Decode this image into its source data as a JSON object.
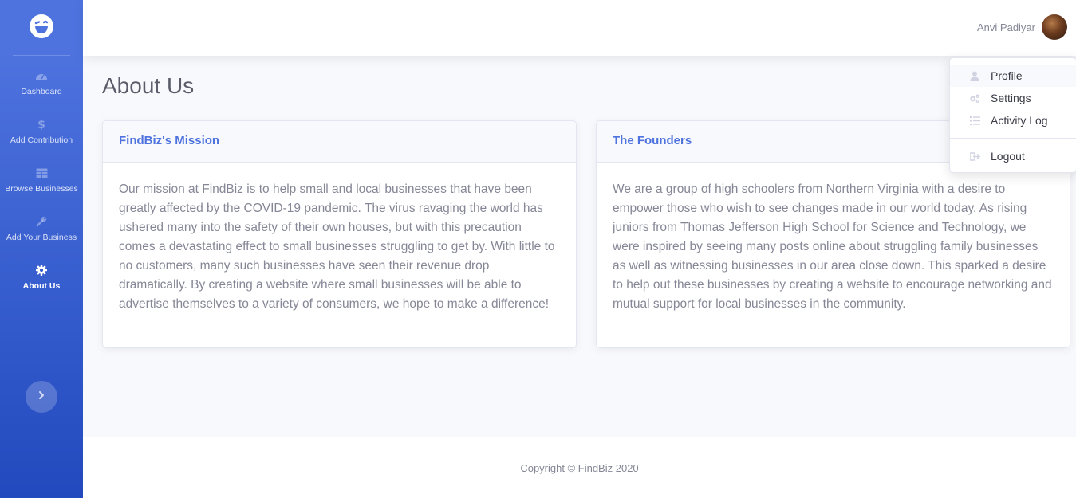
{
  "sidebar": {
    "brand_icon": "laughing-face-icon",
    "items": [
      {
        "label": "Dashboard",
        "icon": "tachometer-icon"
      },
      {
        "label": "Add Contribution",
        "icon": "dollar-icon"
      },
      {
        "label": "Browse Businesses",
        "icon": "table-icon"
      },
      {
        "label": "Add Your Business",
        "icon": "wrench-icon"
      },
      {
        "label": "About Us",
        "icon": "cog-icon",
        "active": true
      }
    ],
    "toggle_icon": "chevron-right-icon",
    "colors": {
      "gradient_start": "#4e73df",
      "gradient_end": "#224abe"
    }
  },
  "topbar": {
    "user_name": "Anvi Padiyar"
  },
  "user_menu": {
    "items": [
      {
        "label": "Profile",
        "icon": "user-icon"
      },
      {
        "label": "Settings",
        "icon": "cogs-icon"
      },
      {
        "label": "Activity Log",
        "icon": "list-icon"
      },
      {
        "label": "Logout",
        "icon": "sign-out-icon"
      }
    ]
  },
  "main": {
    "page_title": "About Us",
    "cards": [
      {
        "title": "FindBiz's Mission",
        "body": "Our mission at FindBiz is to help small and local businesses that have been greatly affected by the COVID-19 pandemic. The virus ravaging the world has ushered many into the safety of their own houses, but with this precaution comes a devastating effect to small businesses struggling to get by. With little to no customers, many such businesses have seen their revenue drop dramatically. By creating a website where small businesses will be able to advertise themselves to a variety of consumers, we hope to make a difference!"
      },
      {
        "title": "The Founders",
        "body": "We are a group of high schoolers from Northern Virginia with a desire to empower those who wish to see changes made in our world today. As rising juniors from Thomas Jefferson High School for Science and Technology, we were inspired by seeing many posts online about struggling family businesses as well as witnessing businesses in our area close down. This sparked a desire to help out these businesses by creating a website to encourage networking and mutual support for local businesses in the community."
      }
    ]
  },
  "footer": {
    "copyright": "Copyright © FindBiz 2020"
  },
  "colors": {
    "primary": "#4e73df",
    "text": "#858796",
    "heading": "#5a5c69"
  }
}
